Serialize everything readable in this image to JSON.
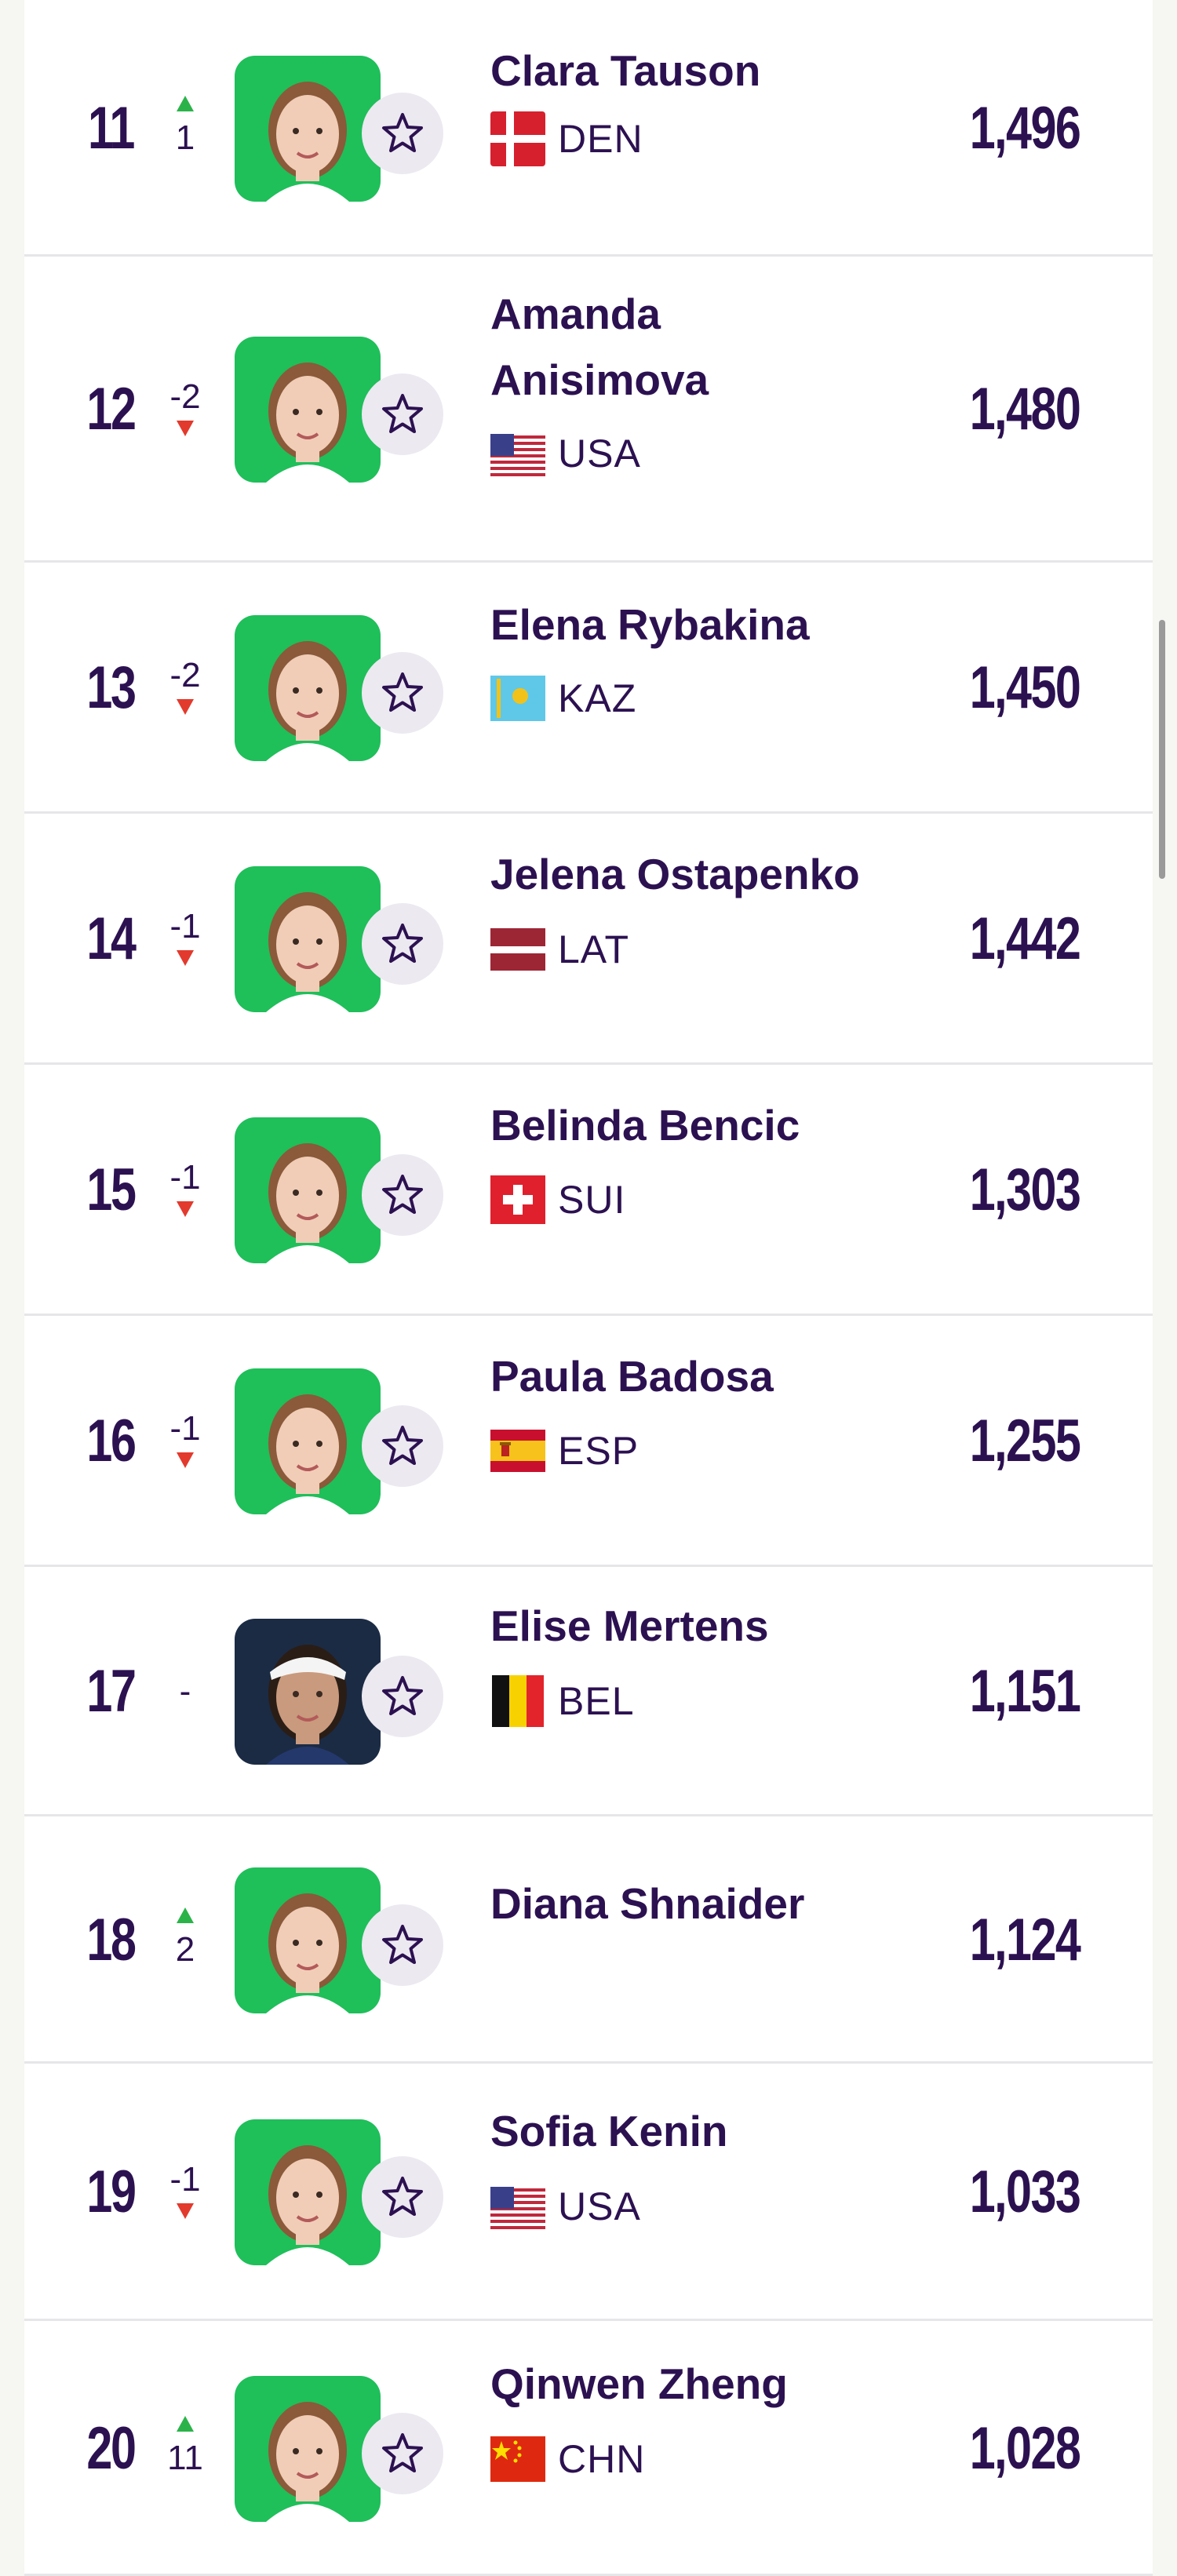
{
  "players": [
    {
      "rank": "11",
      "move": "1",
      "dir": "up",
      "name": "Clara Tauson",
      "country": "DEN",
      "flag": "den",
      "points": "1,496"
    },
    {
      "rank": "12",
      "move": "-2",
      "dir": "down",
      "name": "Amanda Anisimova",
      "country": "USA",
      "flag": "usa",
      "points": "1,480"
    },
    {
      "rank": "13",
      "move": "-2",
      "dir": "down",
      "name": "Elena Rybakina",
      "country": "KAZ",
      "flag": "kaz",
      "points": "1,450"
    },
    {
      "rank": "14",
      "move": "-1",
      "dir": "down",
      "name": "Jelena Ostapenko",
      "country": "LAT",
      "flag": "lat",
      "points": "1,442"
    },
    {
      "rank": "15",
      "move": "-1",
      "dir": "down",
      "name": "Belinda Bencic",
      "country": "SUI",
      "flag": "sui",
      "points": "1,303"
    },
    {
      "rank": "16",
      "move": "-1",
      "dir": "down",
      "name": "Paula Badosa",
      "country": "ESP",
      "flag": "esp",
      "points": "1,255"
    },
    {
      "rank": "17",
      "move": "-",
      "dir": "none",
      "name": "Elise Mertens",
      "country": "BEL",
      "flag": "bel",
      "points": "1,151"
    },
    {
      "rank": "18",
      "move": "2",
      "dir": "up",
      "name": "Diana Shnaider",
      "country": "",
      "flag": "",
      "points": "1,124"
    },
    {
      "rank": "19",
      "move": "-1",
      "dir": "down",
      "name": "Sofia Kenin",
      "country": "USA",
      "flag": "usa",
      "points": "1,033"
    },
    {
      "rank": "20",
      "move": "11",
      "dir": "up",
      "name": "Qinwen Zheng",
      "country": "CHN",
      "flag": "chn",
      "points": "1,028"
    }
  ],
  "icons": {
    "favorite": "star-outline-icon",
    "up": "triangle-up-icon",
    "down": "triangle-down-icon"
  },
  "colors": {
    "text": "#2c1151",
    "up": "#2bb34a",
    "down": "#e23a2d",
    "photo_bg": "#1fbf5a"
  }
}
